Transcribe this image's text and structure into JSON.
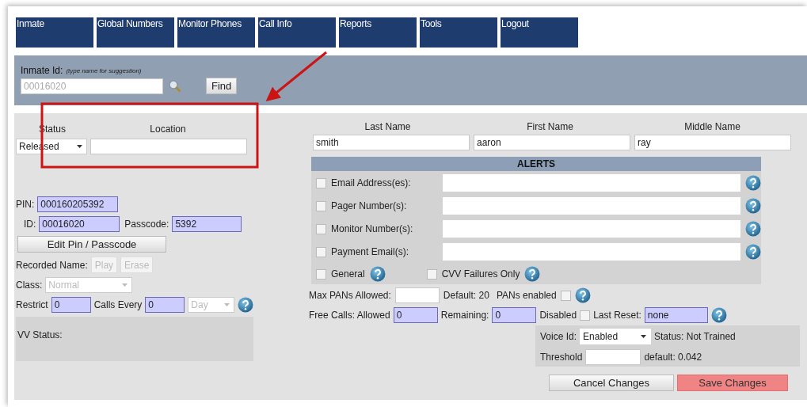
{
  "nav_tabs": [
    {
      "label": "Inmate"
    },
    {
      "label": "Global Numbers"
    },
    {
      "label": "Monitor Phones"
    },
    {
      "label": "Call Info"
    },
    {
      "label": "Reports"
    },
    {
      "label": "Tools"
    },
    {
      "label": "Logout"
    }
  ],
  "search": {
    "label": "Inmate Id:",
    "hint": "(type name for suggestion)",
    "placeholder": "00016020",
    "button": "Find"
  },
  "status": {
    "label": "Status",
    "value": "Released"
  },
  "location": {
    "label": "Location"
  },
  "credentials": {
    "pin_label": "PIN:",
    "pin": "000160205392",
    "id_label": "ID:",
    "id": "00016020",
    "passcode_label": "Passcode:",
    "passcode": "5392",
    "edit_button": "Edit Pin / Passcode"
  },
  "recorded_name": {
    "label": "Recorded Name:",
    "buttons": [
      {
        "label": "Play",
        "disabled": true
      },
      {
        "label": "Erase",
        "disabled": true
      }
    ]
  },
  "class": {
    "label": "Class:",
    "value": "Normal",
    "disabled": true
  },
  "restrict": {
    "label": "Restrict",
    "value": "0",
    "calls_label": "Calls Every",
    "calls_value": "0",
    "period": "Day",
    "period_disabled": true
  },
  "vv_status": {
    "label": "VV Status:"
  },
  "names": [
    {
      "label": "Last Name",
      "value": "smith"
    },
    {
      "label": "First Name",
      "value": "aaron"
    },
    {
      "label": "Middle Name",
      "value": "ray"
    }
  ],
  "alerts": {
    "title": "ALERTS",
    "rows": [
      {
        "label": "Email Address(es):",
        "checked": false
      },
      {
        "label": "Pager Number(s):",
        "checked": false
      },
      {
        "label": "Monitor Number(s):",
        "checked": false
      },
      {
        "label": "Payment Email(s):",
        "checked": false
      }
    ],
    "options": [
      {
        "label": "General",
        "checked": false
      },
      {
        "label": "CVV Failures Only",
        "checked": false
      }
    ]
  },
  "pans": {
    "label": "Max PANs Allowed:",
    "default": "Default: 20",
    "enabled_label": "PANs enabled",
    "enabled": false
  },
  "free_calls": {
    "label": "Free Calls: Allowed",
    "allowed": "0",
    "remaining_label": "Remaining:",
    "remaining": "0",
    "disabled_label": "Disabled",
    "disabled": false,
    "last_reset_label": "Last Reset:",
    "last_reset": "none"
  },
  "voice_id": {
    "label": "Voice Id:",
    "value": "Enabled",
    "status": "Status: Not Trained",
    "threshold_label": "Threshold",
    "default": "default: 0.042"
  },
  "buttons": [
    {
      "label": "Cancel Changes",
      "kind": "cancel"
    },
    {
      "label": "Save Changes",
      "kind": "save"
    }
  ]
}
